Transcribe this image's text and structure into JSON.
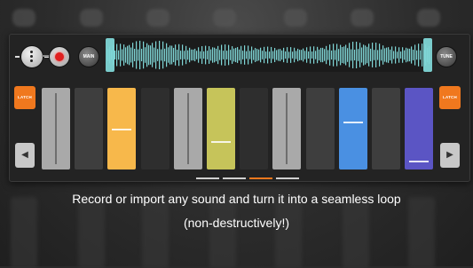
{
  "caption": {
    "line1": "Record or import any sound and turn it into a seamless loop",
    "line2": "(non-destructively!)"
  },
  "toolbar": {
    "main_label": "MAIN",
    "tune_label": "TUNE"
  },
  "latch": {
    "left_label": "LATCH",
    "right_label": "LATCH"
  },
  "nav": {
    "left_arrow": "◀",
    "right_arrow": "▶"
  },
  "colors": {
    "accent_orange": "#f0781e",
    "waveform": "#7fd6d6",
    "record_red": "#e02020"
  },
  "faders": [
    {
      "color": "#a9a9a9",
      "level": null
    },
    {
      "color": "#3e3e3e",
      "level": null
    },
    {
      "color": "#f7b84b",
      "level": 0.5
    },
    {
      "color": "#2e2e2e",
      "level": null
    },
    {
      "color": "#a9a9a9",
      "level": null
    },
    {
      "color": "#c6c45a",
      "level": 0.33
    },
    {
      "color": "#2e2e2e",
      "level": null
    },
    {
      "color": "#a9a9a9",
      "level": null
    },
    {
      "color": "#3e3e3e",
      "level": null
    },
    {
      "color": "#4a90e2",
      "level": 0.6
    },
    {
      "color": "#3e3e3e",
      "level": null
    },
    {
      "color": "#5b55c4",
      "level": 0.05
    }
  ],
  "pages": {
    "count": 4,
    "active": 2
  }
}
